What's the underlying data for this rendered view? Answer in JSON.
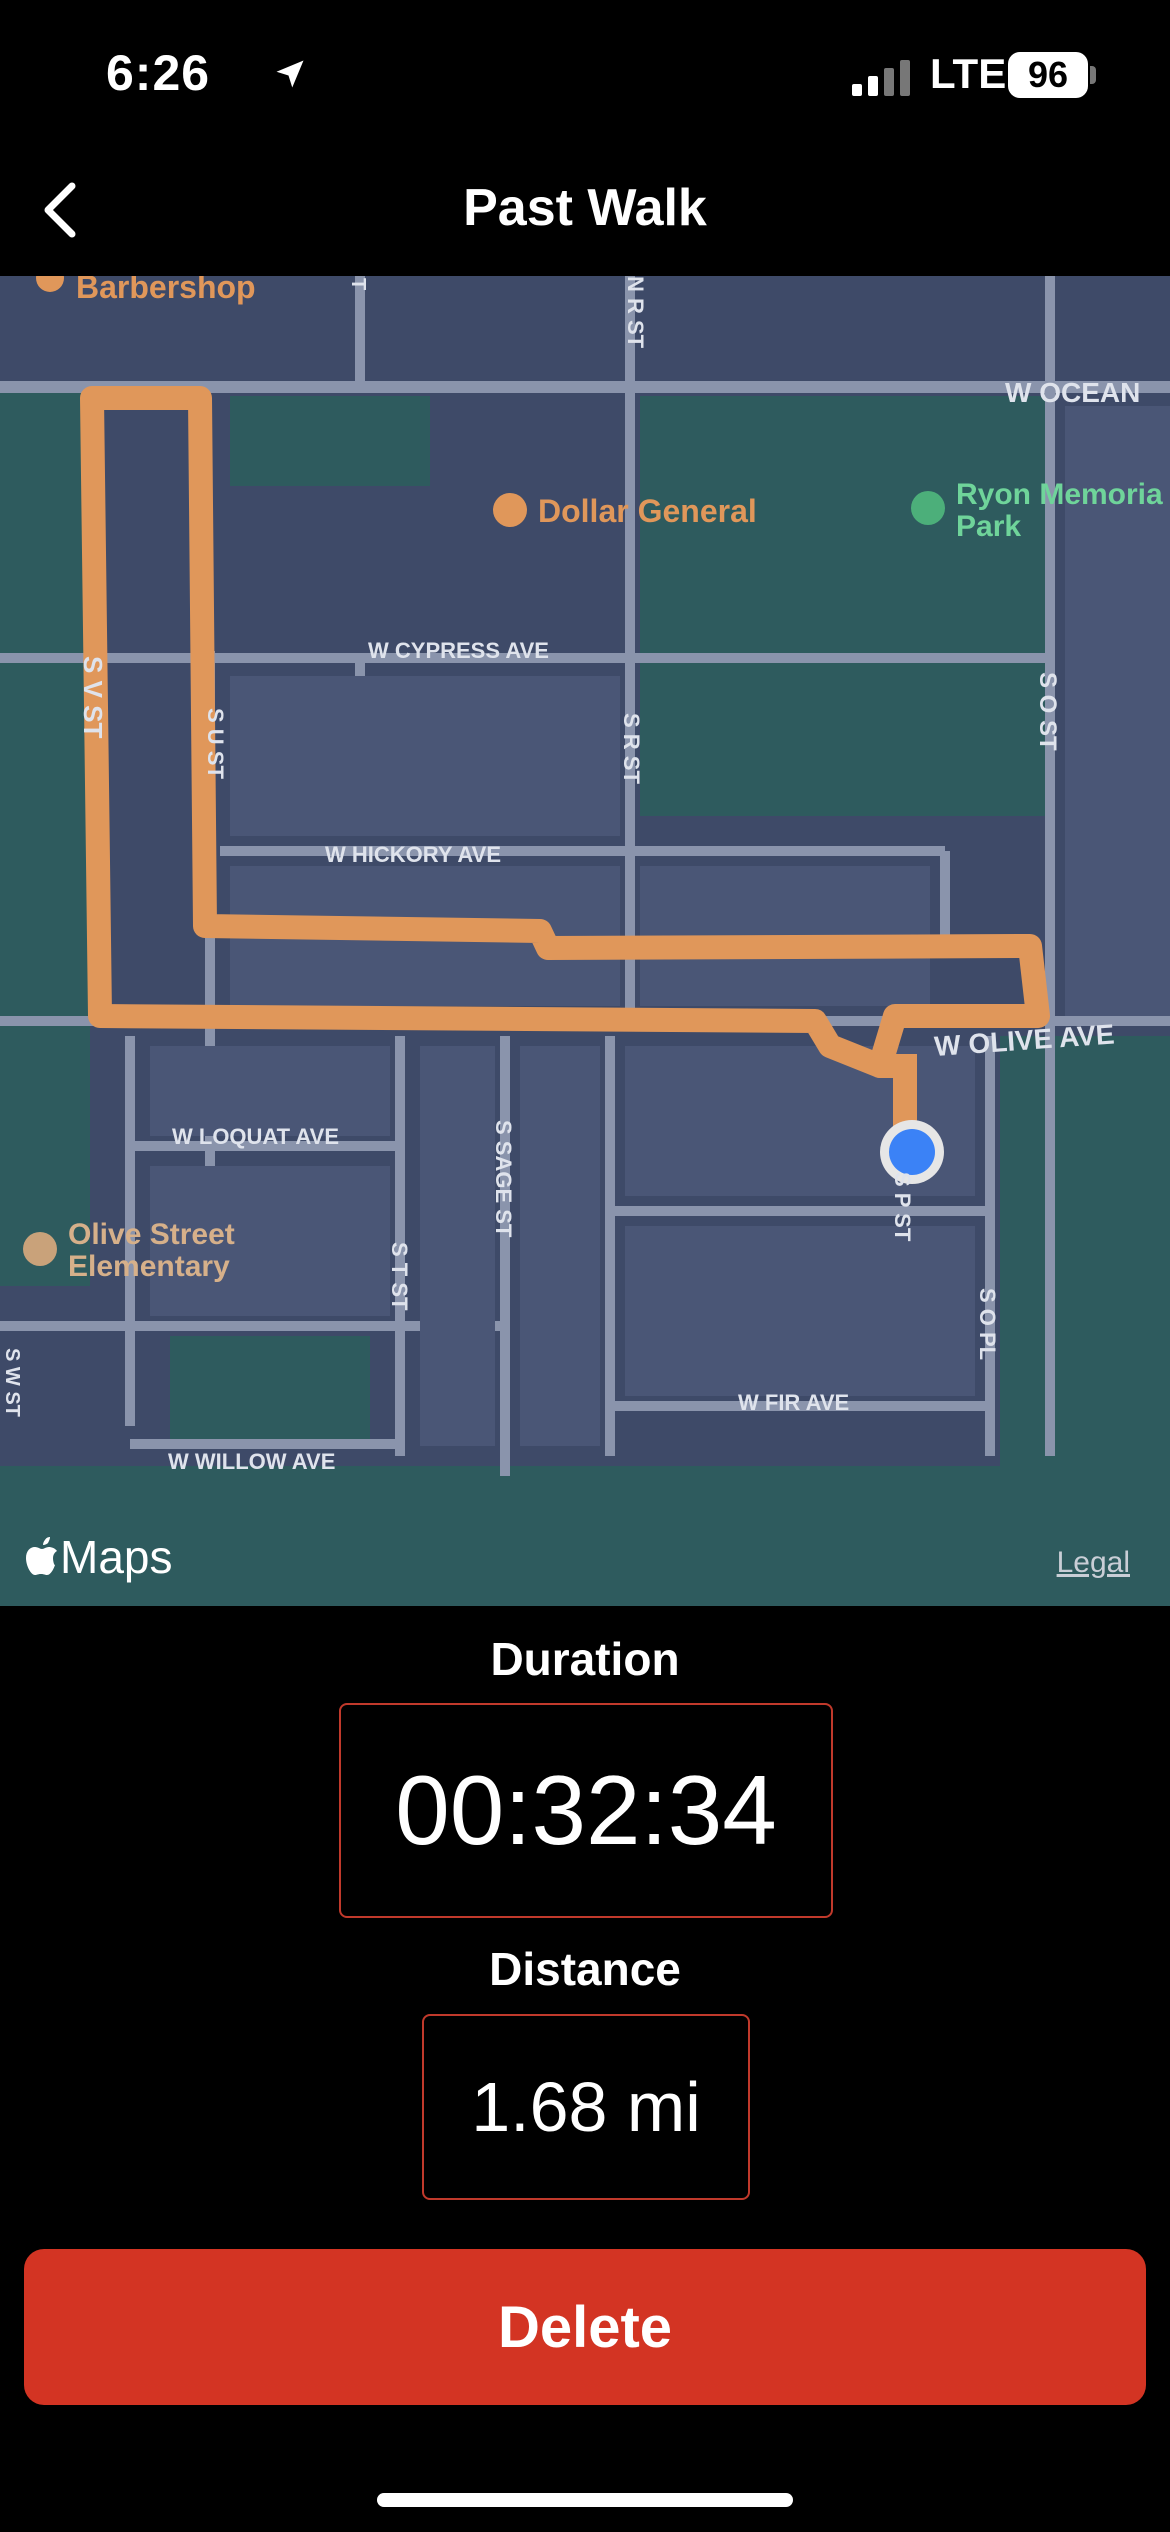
{
  "status_bar": {
    "time": "6:26",
    "network": "LTE",
    "battery": "96"
  },
  "nav": {
    "title": "Past Walk",
    "back_icon": "chevron-left-icon"
  },
  "map": {
    "pois": {
      "barbershop": "Barbershop",
      "dollar_general": "Dollar General",
      "ryon_line1": "Ryon Memoria",
      "ryon_line2": "Park",
      "olive_school_line1": "Olive Street",
      "olive_school_line2": "Elementary"
    },
    "streets": {
      "w_ocean": "W OCEAN",
      "w_cypress": "W CYPRESS AVE",
      "w_hickory": "W HICKORY AVE",
      "w_olive": "W OLIVE AVE",
      "w_loquat": "W LOQUAT AVE",
      "w_fir": "W FIR AVE",
      "w_willow": "W WILLOW AVE",
      "s_v": "S V ST",
      "s_u": "S U ST",
      "s_r": "S R ST",
      "n_r": "N R ST",
      "s_o": "S O ST",
      "s_sage": "S SAGE ST",
      "s_t": "S T ST",
      "s_p": "S P ST",
      "s_o_pl": "S O PL",
      "s_w": "S W ST",
      "t": "T"
    },
    "attribution": "Maps",
    "legal": "Legal",
    "colors": {
      "route": "#e0975a",
      "location": "#3b82f6",
      "park": "#2f5a5a",
      "block": "#3e4a68"
    }
  },
  "stats": {
    "duration_label": "Duration",
    "duration_value": "00:32:34",
    "distance_label": "Distance",
    "distance_value": "1.68 mi"
  },
  "actions": {
    "delete_label": "Delete"
  }
}
